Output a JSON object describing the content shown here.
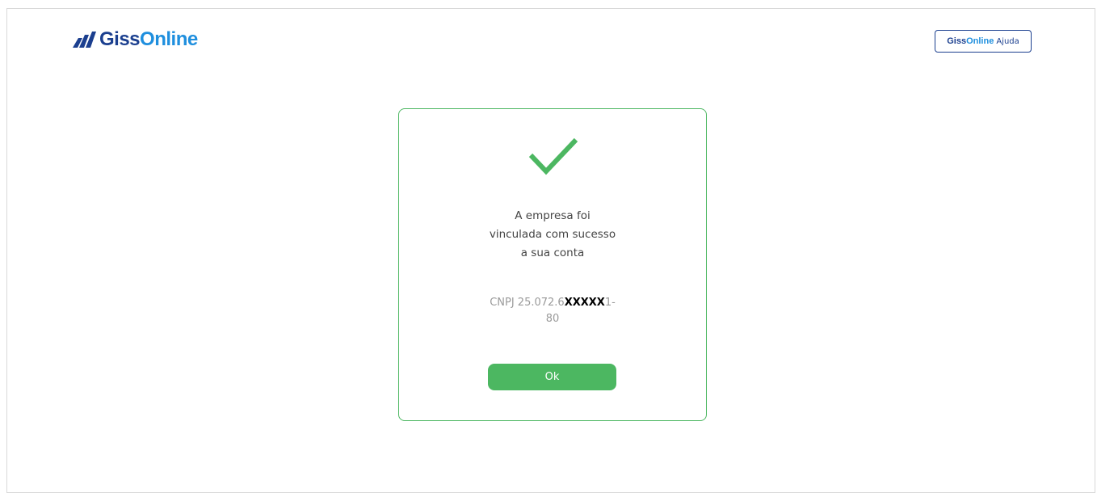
{
  "header": {
    "logo": {
      "part1": "Giss",
      "part2": "Online",
      "icon": "giss-logo-bars-icon"
    },
    "help_button": {
      "brand_part1": "Giss",
      "brand_part2": "Online",
      "label": "Ajuda"
    }
  },
  "dialog": {
    "icon": "checkmark-icon",
    "message_lines": [
      "A empresa foi",
      "vinculada com sucesso",
      "a sua conta"
    ],
    "cnpj": {
      "prefix": "CNPJ 25.072.6",
      "masked": "XXXXX",
      "suffix": "1-",
      "line2": "80"
    },
    "ok_label": "Ok"
  },
  "colors": {
    "brand_dark_blue": "#1b3f8f",
    "brand_light_blue": "#1f8fde",
    "success_green": "#4cb761"
  }
}
